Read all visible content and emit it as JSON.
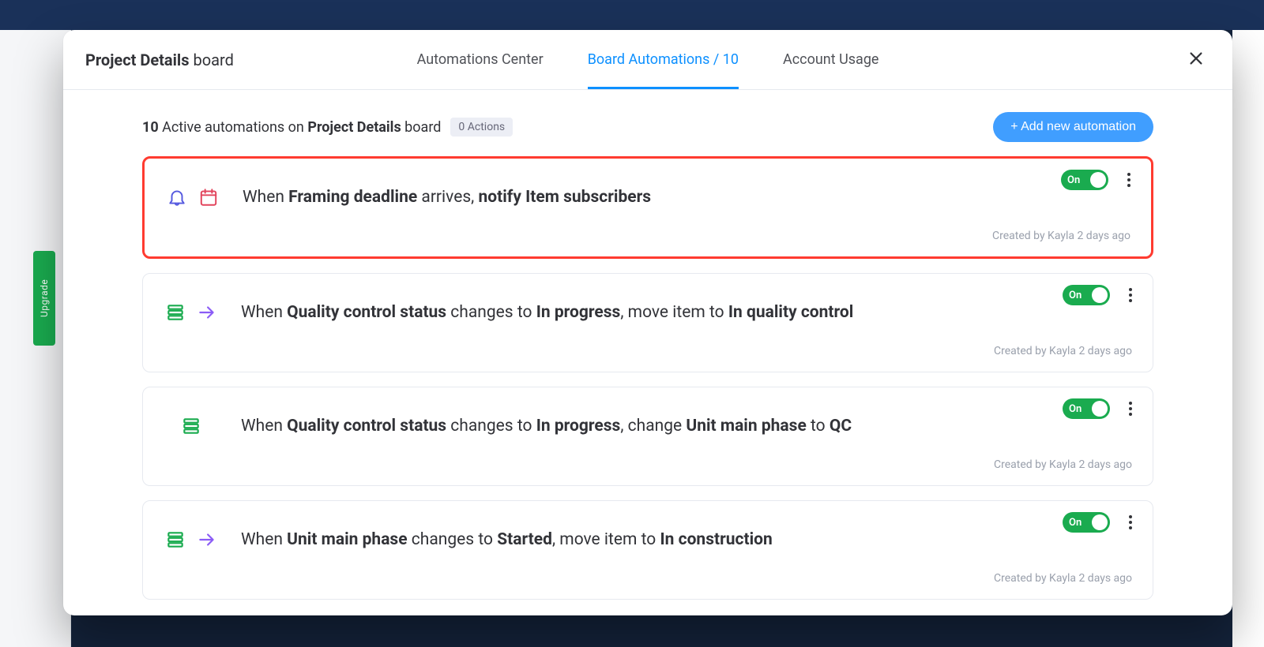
{
  "header": {
    "title_bold": "Project Details",
    "title_light": "board",
    "tabs": {
      "center": "Automations Center",
      "board": "Board Automations / 10",
      "usage": "Account Usage"
    }
  },
  "summary": {
    "count": "10",
    "line_a": "Active automations on",
    "board_name": "Project Details",
    "line_b": "board",
    "actions_badge": "0 Actions",
    "add_button": "+ Add new automation"
  },
  "toggle_label": "On",
  "upgrade_label": "Upgrade",
  "rules": [
    {
      "icons": [
        "bell",
        "calendar"
      ],
      "parts": [
        "When ",
        "Framing deadline",
        " arrives, ",
        "notify Item subscribers"
      ],
      "bold": [
        false,
        true,
        false,
        true
      ],
      "meta": "Created by Kayla 2 days ago",
      "highlight": true
    },
    {
      "icons": [
        "stack",
        "arrow"
      ],
      "parts": [
        "When ",
        "Quality control status",
        " changes to ",
        "In progress",
        ", move item to ",
        "In quality control"
      ],
      "bold": [
        false,
        true,
        false,
        true,
        false,
        true
      ],
      "meta": "Created by Kayla 2 days ago",
      "highlight": false
    },
    {
      "icons": [
        "stack"
      ],
      "parts": [
        "When ",
        "Quality control status",
        " changes to ",
        "In progress",
        ", change ",
        "Unit main phase",
        " to ",
        "QC"
      ],
      "bold": [
        false,
        true,
        false,
        true,
        false,
        true,
        false,
        true
      ],
      "meta": "Created by Kayla 2 days ago",
      "highlight": false
    },
    {
      "icons": [
        "stack",
        "arrow"
      ],
      "parts": [
        "When ",
        "Unit main phase",
        " changes to ",
        "Started",
        ", move item to ",
        "In construction"
      ],
      "bold": [
        false,
        true,
        false,
        true,
        false,
        true
      ],
      "meta": "Created by Kayla 2 days ago",
      "highlight": false
    }
  ]
}
